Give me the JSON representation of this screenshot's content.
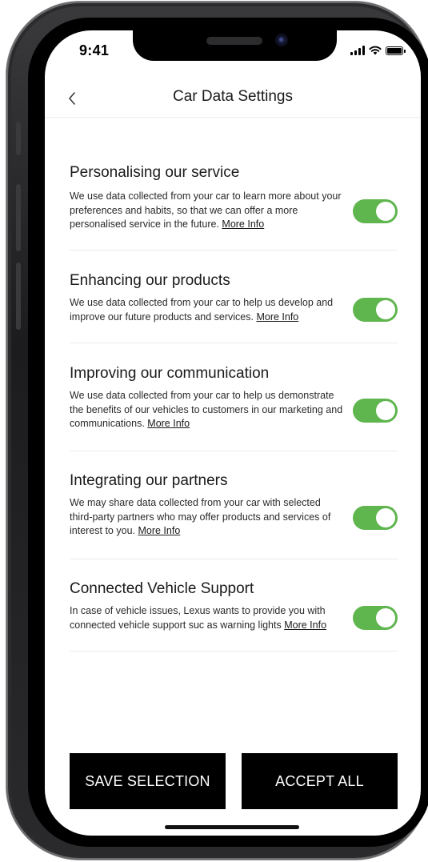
{
  "status_bar": {
    "time": "9:41"
  },
  "nav": {
    "title": "Car Data Settings",
    "back_icon": "chevron-left-icon"
  },
  "sections": [
    {
      "title": "Personalising our service",
      "description": "We use data collected from your car to learn more about your preferences and habits, so that we can offer a more personalised service in the future.",
      "more_info": "More Info",
      "enabled": true
    },
    {
      "title": "Enhancing our products",
      "description": "We use data collected from your car to help us develop and improve our future products and services.",
      "more_info": "More Info",
      "enabled": true
    },
    {
      "title": "Improving our communication",
      "description": "We use data collected from your car to help us demonstrate the benefits of our vehicles to customers in our marketing and communications.",
      "more_info": "More Info",
      "enabled": true
    },
    {
      "title": "Integrating our partners",
      "description": "We may share data collected from your car with selected third-party partners who may offer products and services of interest to you.",
      "more_info": "More Info",
      "enabled": true
    },
    {
      "title": "Connected Vehicle Support",
      "description": "In case of vehicle issues, Lexus wants to provide you with connected vehicle support suc as warning lights",
      "more_info": "More Info",
      "enabled": true
    }
  ],
  "buttons": {
    "save": "SAVE SELECTION",
    "accept_all": "ACCEPT ALL"
  },
  "colors": {
    "toggle_on": "#5fb54e",
    "button_bg": "#000000",
    "button_text": "#ffffff"
  }
}
